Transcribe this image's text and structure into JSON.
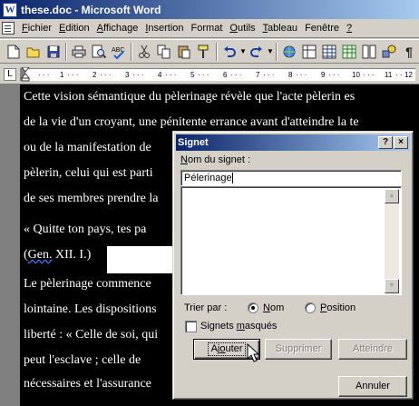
{
  "window": {
    "title": "these.doc - Microsoft Word",
    "app_icon_letter": "W"
  },
  "menubar": {
    "items": [
      {
        "accel": "F",
        "rest": "ichier"
      },
      {
        "accel": "E",
        "rest": "dition"
      },
      {
        "accel": "A",
        "rest": "ffichage"
      },
      {
        "accel": "I",
        "rest": "nsertion"
      },
      {
        "accel": "",
        "rest": "Format"
      },
      {
        "accel": "O",
        "rest": "utils"
      },
      {
        "accel": "T",
        "rest": "ableau"
      },
      {
        "accel": "",
        "rest": "Fenêtre"
      },
      {
        "accel": "?",
        "rest": ""
      }
    ]
  },
  "toolbar": {
    "icons": [
      "new-icon",
      "open-icon",
      "save-icon",
      "print-icon",
      "print-preview-icon",
      "spelling-icon",
      "cut-icon",
      "copy-icon",
      "paste-icon",
      "format-painter-icon",
      "undo-icon",
      "redo-icon",
      "hyperlink-icon",
      "tables-borders-icon",
      "insert-table-icon",
      "insert-excel-icon",
      "columns-icon",
      "drawing-icon",
      "show-hide-icon"
    ]
  },
  "ruler": {
    "ticks": [
      "1",
      "2",
      "3",
      "4",
      "5",
      "6",
      "7",
      "8",
      "9",
      "10",
      "11",
      "12"
    ]
  },
  "document": {
    "lines": [
      "Cette vision sémantique du pèlerinage révèle que l'acte pèlerin es",
      "de la vie d'un croyant, une pénitente errance avant d'atteindre la te",
      "ou de la manifestation de",
      "pèlerin, celui qui est parti",
      "de ses membres prendre la",
      "« Quitte ton pays, tes pa",
      "(Gen. XII. I.)",
      "Le pèlerinage commence",
      "lointaine. Les dispositions",
      "liberté : « Celle de soi, qui",
      "peut l'esclave ; celle de",
      "nécessaires et l'assurance"
    ],
    "gen_ref": "Gen."
  },
  "dialog": {
    "title": "Signet",
    "help_button": "?",
    "close_button": "×",
    "name_label_accel": "N",
    "name_label_rest": "om du signet :",
    "name_value": "Pélerinage",
    "sort_label": "Trier par :",
    "sort_options": [
      {
        "accel": "N",
        "rest": "om",
        "checked": true
      },
      {
        "accel": "P",
        "rest": "osition",
        "checked": false
      }
    ],
    "hidden_label_pre": "Signets ",
    "hidden_label_accel": "m",
    "hidden_label_post": "asqués",
    "hidden_checked": false,
    "buttons": {
      "add": {
        "pre": "Aj",
        "accel": "o",
        "post": "uter"
      },
      "delete": "Supprimer",
      "goto": "Atteindre",
      "cancel": "Annuler"
    }
  }
}
